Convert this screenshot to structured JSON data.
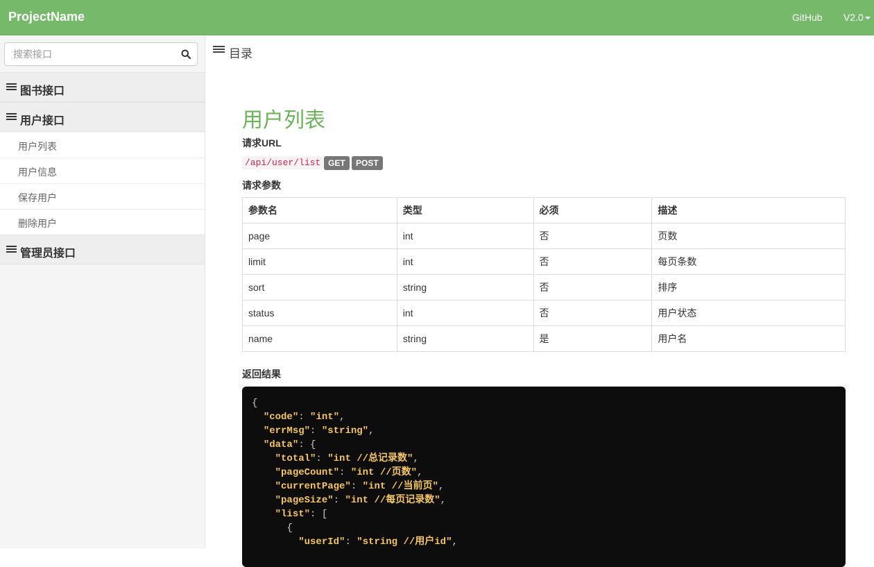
{
  "navbar": {
    "brand": "ProjectName",
    "github_label": "GitHub",
    "version_label": "V2.0"
  },
  "sidebar": {
    "search": {
      "placeholder": "搜索接口",
      "value": ""
    },
    "groups": [
      {
        "label": "图书接口",
        "items": []
      },
      {
        "label": "用户接口",
        "items": [
          {
            "label": "用户列表"
          },
          {
            "label": "用户信息"
          },
          {
            "label": "保存用户"
          },
          {
            "label": "删除用户"
          }
        ]
      },
      {
        "label": "管理员接口",
        "items": []
      }
    ]
  },
  "main": {
    "toc_label": "目录",
    "api_title": "用户列表",
    "request_url_label": "请求URL",
    "url": "/api/user/list",
    "methods": [
      "GET",
      "POST"
    ],
    "params_label": "请求参数",
    "params_table": {
      "headers": [
        "参数名",
        "类型",
        "必须",
        "描述"
      ],
      "rows": [
        [
          "page",
          "int",
          "否",
          "页数"
        ],
        [
          "limit",
          "int",
          "否",
          "每页条数"
        ],
        [
          "sort",
          "string",
          "否",
          "排序"
        ],
        [
          "status",
          "int",
          "否",
          "用户状态"
        ],
        [
          "name",
          "string",
          "是",
          "用户名"
        ]
      ]
    },
    "result_label": "返回结果",
    "code_lines": [
      {
        "indent": "",
        "key": "",
        "value": "",
        "text": "{"
      },
      {
        "indent": "  ",
        "key": "\"code\"",
        "value": "\"int\"",
        "tail": ","
      },
      {
        "indent": "  ",
        "key": "\"errMsg\"",
        "value": "\"string\"",
        "tail": ","
      },
      {
        "indent": "  ",
        "key": "\"data\"",
        "value": "",
        "tail": "{"
      },
      {
        "indent": "    ",
        "key": "\"total\"",
        "value": "\"int //总记录数\"",
        "tail": ","
      },
      {
        "indent": "    ",
        "key": "\"pageCount\"",
        "value": "\"int //页数\"",
        "tail": ","
      },
      {
        "indent": "    ",
        "key": "\"currentPage\"",
        "value": "\"int //当前页\"",
        "tail": ","
      },
      {
        "indent": "    ",
        "key": "\"pageSize\"",
        "value": "\"int //每页记录数\"",
        "tail": ","
      },
      {
        "indent": "    ",
        "key": "\"list\"",
        "value": "",
        "tail": "["
      },
      {
        "indent": "      ",
        "key": "",
        "value": "",
        "text": "{"
      },
      {
        "indent": "        ",
        "key": "\"userId\"",
        "value": "\"string //用户id\"",
        "tail": ","
      }
    ]
  }
}
